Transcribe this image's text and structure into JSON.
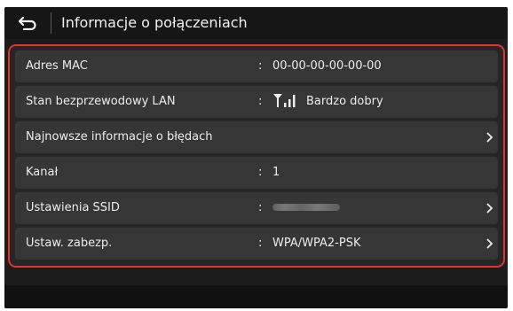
{
  "header": {
    "title": "Informacje o połączeniach",
    "back_icon": "return-arrow-icon"
  },
  "rows": [
    {
      "label": "Adres MAC",
      "separator": ":",
      "value": "00-00-00-00-00-00"
    },
    {
      "label": "Stan bezprzewodowy LAN",
      "separator": ":",
      "value": "Bardzo dobry",
      "icon": "signal-strength-icon"
    },
    {
      "label": "Najnowsze informacje o błędach",
      "icon": "chevron-right-icon"
    },
    {
      "label": "Kanał",
      "separator": ":",
      "value": "1"
    },
    {
      "label": "Ustawienia SSID",
      "separator": ":",
      "value_obscured": true,
      "icon": "chevron-right-icon"
    },
    {
      "label": "Ustaw. zabezp.",
      "separator": ":",
      "value": "WPA/WPA2-PSK",
      "icon": "chevron-right-icon"
    }
  ],
  "colors": {
    "highlight_border": "#e5342f",
    "screen_bg": "#1c1c1c",
    "row_bg": "#363636",
    "text": "#ececec"
  }
}
